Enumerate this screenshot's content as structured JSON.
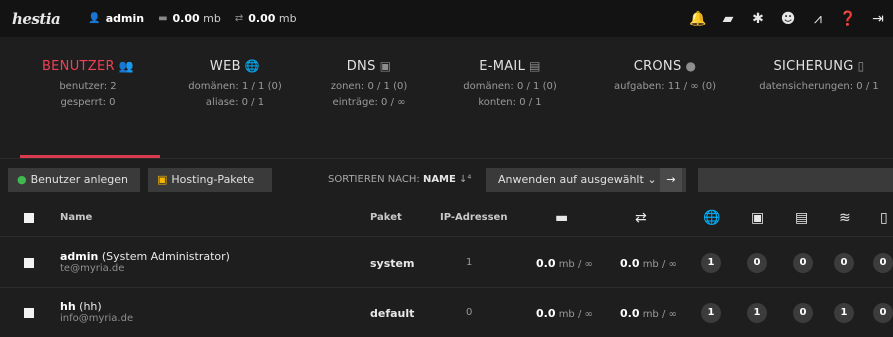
{
  "app": {
    "logo": "hestia"
  },
  "topbar": {
    "user": "admin",
    "disk": "0.00",
    "disk_unit": "mb",
    "bandwidth": "0.00",
    "bandwidth_unit": "mb",
    "icons": [
      "bell-icon",
      "folder-icon",
      "gear-icon",
      "user-circle-icon",
      "chart-icon",
      "help-icon",
      "logout-icon"
    ],
    "accent_bell": "#f5b400"
  },
  "stats": [
    {
      "title": "BENUTZER",
      "icon": "users-icon",
      "lines": [
        "benutzer: 2",
        "gesperrt: 0"
      ],
      "active": true
    },
    {
      "title": "WEB",
      "icon": "globe-icon",
      "lines": [
        "domänen: 1 / 1 (0)",
        "aliase: 0 / 1"
      ]
    },
    {
      "title": "DNS",
      "icon": "dns-icon",
      "lines": [
        "zonen: 0 / 1 (0)",
        "einträge: 0 / ∞"
      ]
    },
    {
      "title": "E-MAIL",
      "icon": "mail-server-icon",
      "lines": [
        "domänen: 0 / 1 (0)",
        "konten: 0 / 1"
      ]
    },
    {
      "title": "CRONS",
      "icon": "clock-icon",
      "lines": [
        "aufgaben: 11 / ∞ (0)"
      ]
    },
    {
      "title": "SICHERUNG",
      "icon": "file-icon",
      "lines": [
        "datensicherungen: 0 / 1"
      ]
    }
  ],
  "toolbar": {
    "add_user": "Benutzer anlegen",
    "packages": "Hosting-Pakete",
    "sort_label": "SORTIEREN NACH:",
    "sort_value": "NAME",
    "sort_icon": "↓⁴",
    "bulk_select": "Anwenden auf ausgewählt",
    "bulk_caret": "⌄",
    "apply_arrow": "→"
  },
  "table": {
    "headers": {
      "name": "Name",
      "package": "Paket",
      "ip": "IP-Adressen"
    },
    "rows": [
      {
        "user": "admin",
        "fullname": "(System Administrator)",
        "email": "te@myria.de",
        "package": "system",
        "ips": "1",
        "disk_val": "0.0",
        "disk_rest": "mb / ∞",
        "bw_val": "0.0",
        "bw_rest": "mb / ∞",
        "web": "1",
        "dns": "0",
        "mail": "0",
        "db": "0",
        "backup": "0"
      },
      {
        "user": "hh",
        "fullname": "(hh)",
        "email": "info@myria.de",
        "package": "default",
        "ips": "0",
        "disk_val": "0.0",
        "disk_rest": "mb / ∞",
        "bw_val": "0.0",
        "bw_rest": "mb / ∞",
        "web": "1",
        "dns": "1",
        "mail": "0",
        "db": "1",
        "backup": "0"
      }
    ]
  },
  "colors": {
    "active_red": "#ef4055",
    "green": "#3fb950"
  }
}
